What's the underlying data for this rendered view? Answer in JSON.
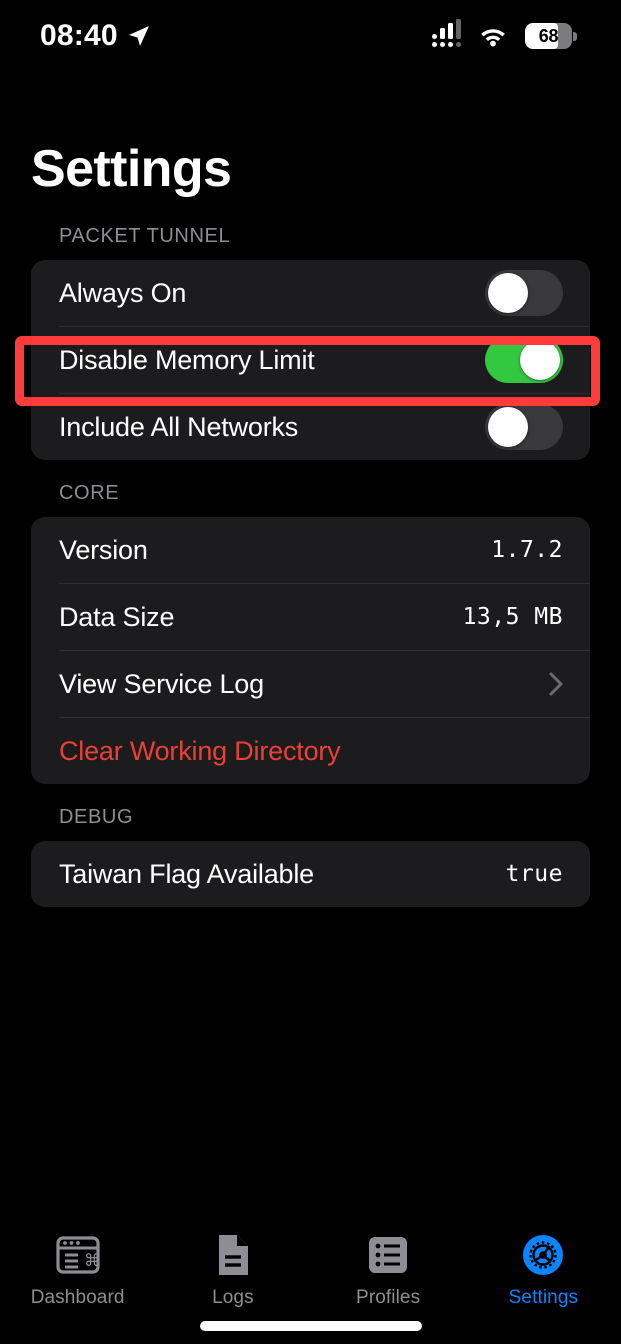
{
  "status_bar": {
    "time": "08:40",
    "location_icon": "location-arrow-icon",
    "cellular_icon": "cellular-signal-icon",
    "wifi_icon": "wifi-icon",
    "battery_percent": "68"
  },
  "header": {
    "title": "Settings"
  },
  "sections": [
    {
      "header": "PACKET TUNNEL",
      "rows": [
        {
          "label": "Always On",
          "type": "toggle",
          "value": "off"
        },
        {
          "label": "Disable Memory Limit",
          "type": "toggle",
          "value": "on",
          "highlighted": true
        },
        {
          "label": "Include All Networks",
          "type": "toggle",
          "value": "off"
        }
      ]
    },
    {
      "header": "CORE",
      "rows": [
        {
          "label": "Version",
          "type": "value",
          "value": "1.7.2"
        },
        {
          "label": "Data Size",
          "type": "value",
          "value": "13,5 MB"
        },
        {
          "label": "View Service Log",
          "type": "disclosure",
          "value": ""
        },
        {
          "label": "Clear Working Directory",
          "type": "action",
          "value": "",
          "destructive": true
        }
      ]
    },
    {
      "header": "DEBUG",
      "rows": [
        {
          "label": "Taiwan Flag Available",
          "type": "value",
          "value": "true"
        }
      ]
    }
  ],
  "tab_bar": {
    "tabs": [
      {
        "label": "Dashboard",
        "icon": "dashboard-window-icon",
        "active": false
      },
      {
        "label": "Logs",
        "icon": "document-icon",
        "active": false
      },
      {
        "label": "Profiles",
        "icon": "list-icon",
        "active": false
      },
      {
        "label": "Settings",
        "icon": "gear-icon",
        "active": true
      }
    ]
  },
  "colors": {
    "accent": "#0a84ff",
    "toggle_on": "#32c840",
    "destructive": "#eb4034",
    "highlight": "#ff3b3b",
    "card_bg": "#1c1c1e",
    "page_bg": "#000000"
  }
}
